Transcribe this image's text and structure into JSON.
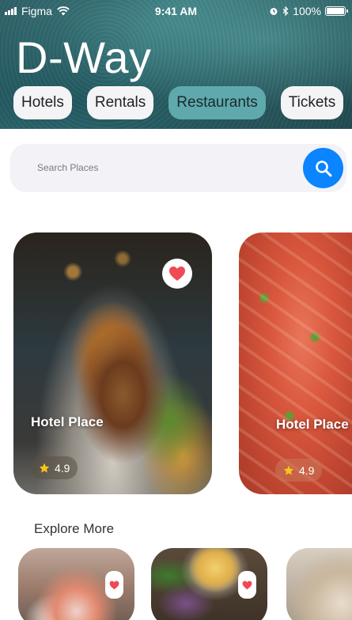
{
  "status_bar": {
    "carrier": "Figma",
    "time": "9:41 AM",
    "battery": "100%",
    "battery_level": 1.0
  },
  "header": {
    "title": "D-Way",
    "tabs": [
      {
        "label": "Hotels",
        "active": false
      },
      {
        "label": "Rentals",
        "active": false
      },
      {
        "label": "Restaurants",
        "active": true
      },
      {
        "label": "Tickets",
        "active": false
      }
    ]
  },
  "search": {
    "placeholder": "Search Places",
    "value": "",
    "button_icon": "search-icon"
  },
  "featured": [
    {
      "title": "Hotel Place",
      "rating": "4.9",
      "favorite": true,
      "image": "burger-photo"
    },
    {
      "title": "Hotel Place",
      "rating": "4.9",
      "favorite": false,
      "image": "salmon-photo"
    }
  ],
  "explore": {
    "title": "Explore More",
    "items": [
      {
        "image": "sushi-photo",
        "favorite": true
      },
      {
        "image": "dessert-bowl-photo",
        "favorite": true
      },
      {
        "image": "soup-photo",
        "favorite": false
      }
    ]
  },
  "colors": {
    "accent": "#0a84ff",
    "active_tab": "#5fa9ad",
    "heart": "#ef4a55",
    "star": "#f5c518"
  }
}
